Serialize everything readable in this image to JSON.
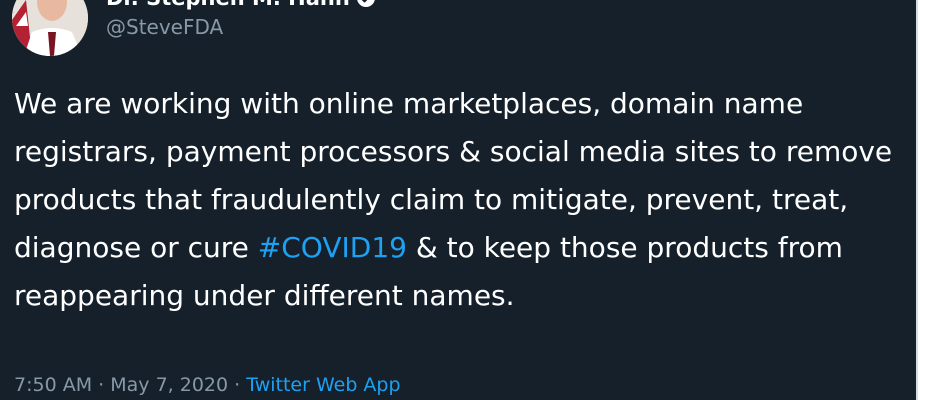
{
  "author": {
    "display_name": "Dr. Stephen M. Hahn",
    "handle": "@SteveFDA",
    "verified": true,
    "avatar_icon": "profile-photo"
  },
  "tweet": {
    "text_before": "We are working with online marketplaces, domain name registrars, payment processors & social media sites to remove products that fraudulently claim to mitigate, prevent, treat, diagnose or cure ",
    "hashtag": "#COVID19",
    "text_after": " & to keep those products from reappearing under different names.",
    "time": "7:50 AM",
    "separator": "·",
    "date": "May 7, 2020",
    "source": "Twitter Web App"
  },
  "colors": {
    "background": "#15202b",
    "text": "#ffffff",
    "secondary": "#8899a6",
    "link": "#1da1f2"
  }
}
